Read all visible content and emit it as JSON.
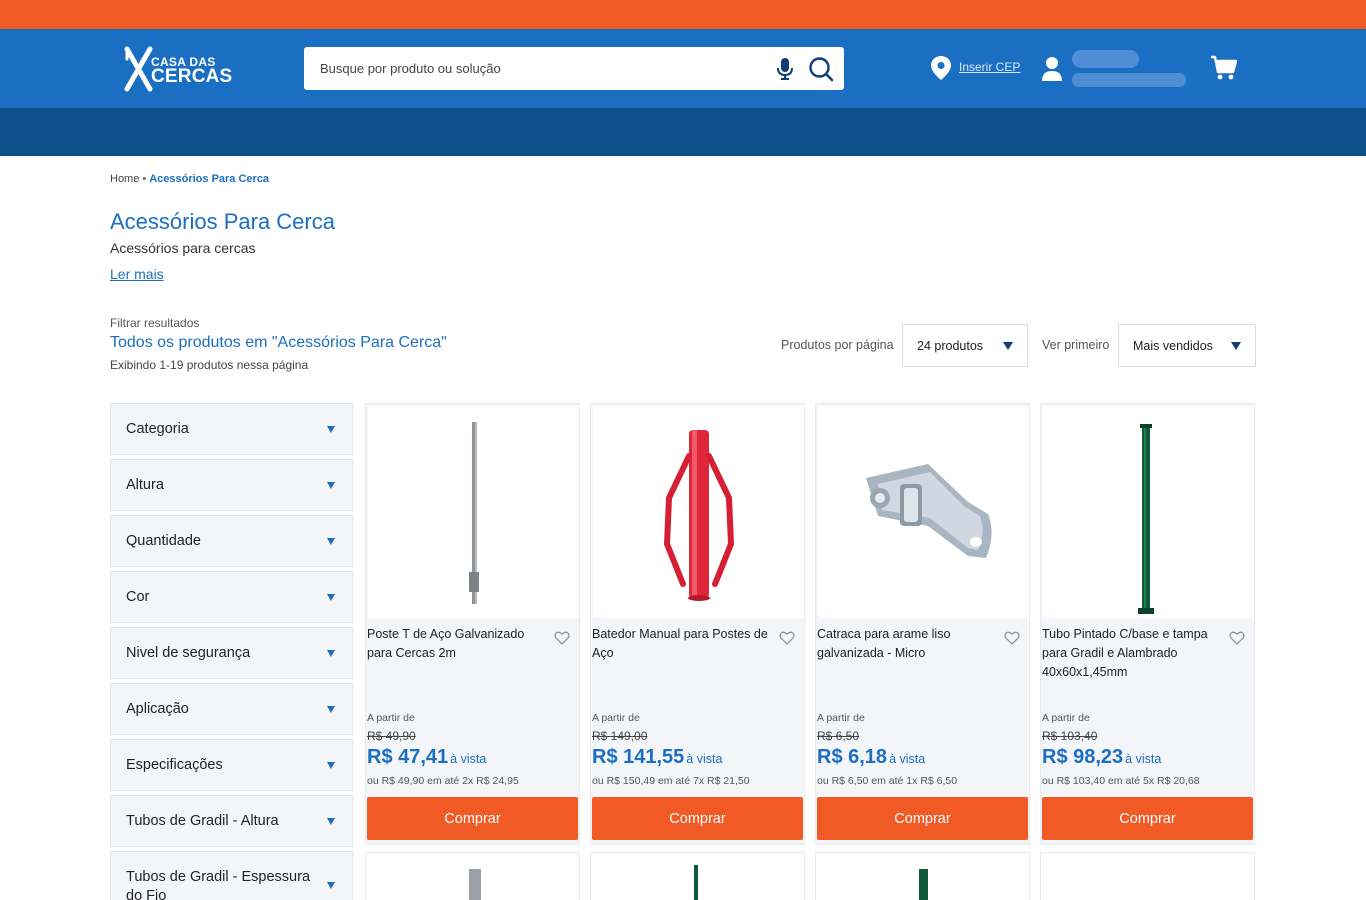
{
  "header": {
    "logo_line1": "CASA DAS",
    "logo_line2": "CERCAS",
    "search_placeholder": "Busque por produto ou solução",
    "cep_link": "Inserir CEP",
    "icons": [
      "microphone-icon",
      "search-icon",
      "location-pin-icon",
      "user-icon",
      "cart-icon"
    ]
  },
  "breadcrumb": {
    "home": "Home",
    "separator": "•",
    "current": "Acessórios Para Cerca"
  },
  "category": {
    "title": "Acessórios Para Cerca",
    "description": "Acessórios para cercas",
    "read_more": "Ler mais"
  },
  "results": {
    "filter_label": "Filtrar resultados",
    "all_products": "Todos os produtos em \"Acessórios Para Cerca\"",
    "showing": "Exibindo 1-19 produtos nessa página",
    "per_page_label": "Produtos por página",
    "per_page_value": "24 produtos",
    "sort_label": "Ver primeiro",
    "sort_value": "Mais vendidos"
  },
  "facets": [
    "Categoria",
    "Altura",
    "Quantidade",
    "Cor",
    "Nivel de segurança",
    "Aplicação",
    "Especificações",
    "Tubos de Gradil - Altura",
    "Tubos de Gradil - Espessura do Fio"
  ],
  "products": [
    {
      "name": "Poste T de Aço Galvanizado para Cercas 2m",
      "from": "A partir de",
      "old_price": "R$ 49,90",
      "price": "R$ 47,41",
      "cash": "à vista",
      "installments": "ou R$ 49,90 em até 2x R$ 24,95",
      "buy": "Comprar"
    },
    {
      "name": "Batedor Manual para Postes de Aço",
      "from": "A partir de",
      "old_price": "R$ 149,00",
      "price": "R$ 141,55",
      "cash": "à vista",
      "installments": "ou R$ 150,49 em até 7x R$ 21,50",
      "buy": "Comprar"
    },
    {
      "name": "Catraca para arame liso galvanizada - Micro",
      "from": "A partir de",
      "old_price": "R$ 6,50",
      "price": "R$ 6,18",
      "cash": "à vista",
      "installments": "ou R$ 6,50 em até 1x R$ 6,50",
      "buy": "Comprar"
    },
    {
      "name": "Tubo Pintado C/base e tampa para Gradil e Alambrado 40x60x1,45mm",
      "from": "A partir de",
      "old_price": "R$ 103,40",
      "price": "R$ 98,23",
      "cash": "à vista",
      "installments": "ou R$ 103,40 em até 5x R$ 20,68",
      "buy": "Comprar"
    }
  ],
  "colors": {
    "orange": "#f15a24",
    "blue": "#1a6fc2",
    "dark_blue": "#0e5089"
  }
}
